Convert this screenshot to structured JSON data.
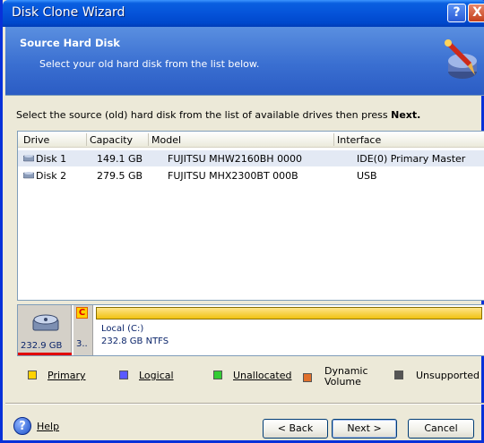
{
  "window": {
    "title": "Disk Clone Wizard",
    "help_glyph": "?",
    "close_glyph": "X"
  },
  "banner": {
    "title": "Source Hard Disk",
    "subtitle": "Select your old hard disk from the list below.",
    "icon": "disk-clone-icon"
  },
  "instruction": {
    "text": "Select the source (old) hard disk from the list of available drives then press ",
    "bold": "Next."
  },
  "table": {
    "columns": [
      "Drive",
      "Capacity",
      "Model",
      "Interface"
    ],
    "rows": [
      {
        "drive": "Disk 1",
        "capacity": "149.1 GB",
        "model": "FUJITSU MHW2160BH 0000",
        "interface": "IDE(0) Primary Master"
      },
      {
        "drive": "Disk 2",
        "capacity": "279.5 GB",
        "model": "FUJITSU MHX2300BT 000B",
        "interface": "USB"
      }
    ]
  },
  "diskmap": {
    "disk_size": "232.9 GB",
    "part_letter": "C",
    "part_small_label": "3..",
    "volume_name": "Local (C:)",
    "volume_info": "232.8 GB  NTFS"
  },
  "legend": [
    {
      "label": "Primary",
      "color": "#ffd200"
    },
    {
      "label": "Logical",
      "color": "#5a5aff"
    },
    {
      "label": "Unallocated",
      "color": "#33cc33"
    },
    {
      "label": "Dynamic\nVolume",
      "color": "#e0702c"
    },
    {
      "label": "Unsupported",
      "color": "#555555"
    }
  ],
  "footer": {
    "help": "Help",
    "back": "< Back",
    "next": "Next >",
    "cancel": "Cancel"
  }
}
